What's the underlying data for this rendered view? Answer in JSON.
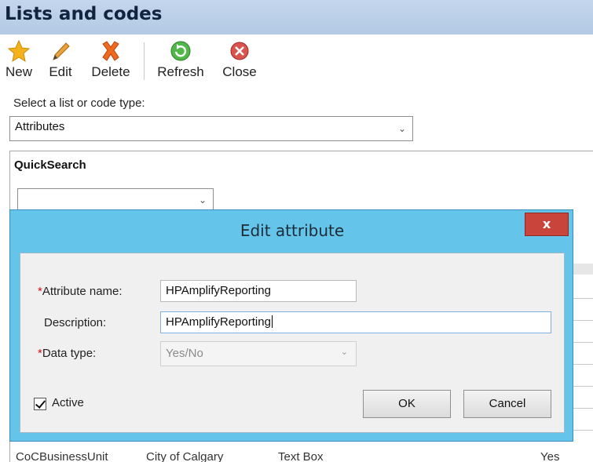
{
  "window": {
    "title": "Lists and codes"
  },
  "toolbar": {
    "new_label": "New",
    "edit_label": "Edit",
    "delete_label": "Delete",
    "refresh_label": "Refresh",
    "close_label": "Close"
  },
  "selector": {
    "label": "Select a list or code type:",
    "value": "Attributes"
  },
  "quicksearch": {
    "title": "QuickSearch",
    "value": ""
  },
  "background_row": {
    "cells": [
      "CoCBusinessUnit",
      "City of Calgary",
      "Text Box",
      "Yes"
    ]
  },
  "dialog": {
    "title": "Edit attribute",
    "close_glyph": "x",
    "required_marker": "*",
    "fields": {
      "attribute_name_label": "Attribute name:",
      "attribute_name_value": "HPAmplifyReporting",
      "description_label": "Description:",
      "description_value": "HPAmplifyReporting",
      "data_type_label": "Data type:",
      "data_type_value": "Yes/No"
    },
    "active_label": "Active",
    "active_checked": true,
    "ok_label": "OK",
    "cancel_label": "Cancel"
  },
  "colors": {
    "dialog_frame": "#64c4ea",
    "close_button": "#c9453b",
    "required": "#d21010"
  },
  "icons": {
    "new": "star-icon",
    "edit": "pencil-icon",
    "delete": "x-icon",
    "refresh": "refresh-icon",
    "close": "close-circle-icon"
  }
}
